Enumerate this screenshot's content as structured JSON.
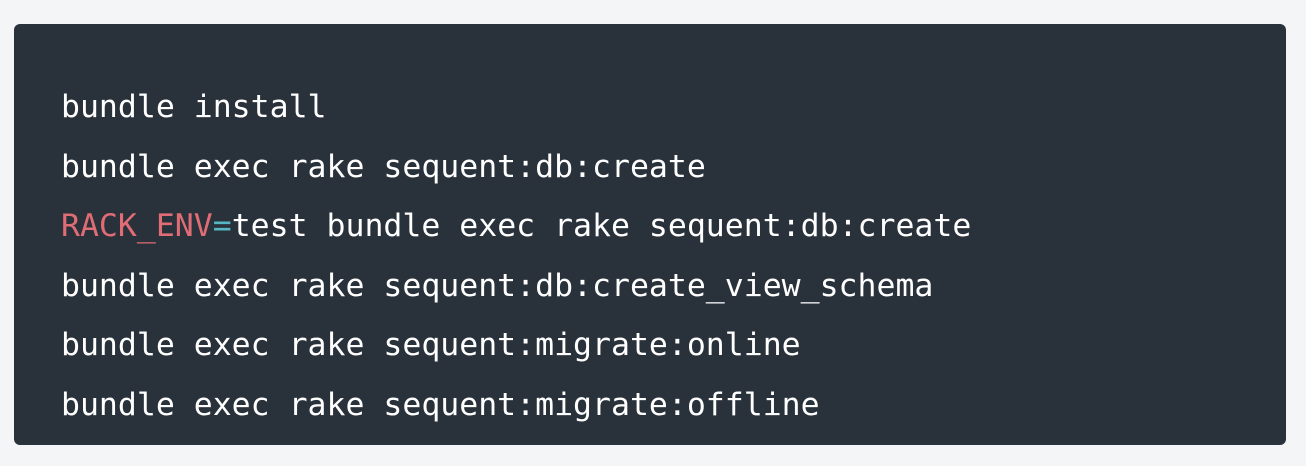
{
  "code_block": {
    "colors": {
      "background": "#29313a",
      "text": "#ffffff",
      "env_var": "#e06c75",
      "operator": "#56b6c2"
    },
    "lines": [
      {
        "text": "bundle install"
      },
      {
        "text": "bundle exec rake sequent:db:create"
      },
      {
        "env_name": "RACK_ENV",
        "operator": "=",
        "rest": "test bundle exec rake sequent:db:create"
      },
      {
        "text": "bundle exec rake sequent:db:create_view_schema"
      },
      {
        "text": "bundle exec rake sequent:migrate:online"
      },
      {
        "text": "bundle exec rake sequent:migrate:offline"
      }
    ]
  }
}
